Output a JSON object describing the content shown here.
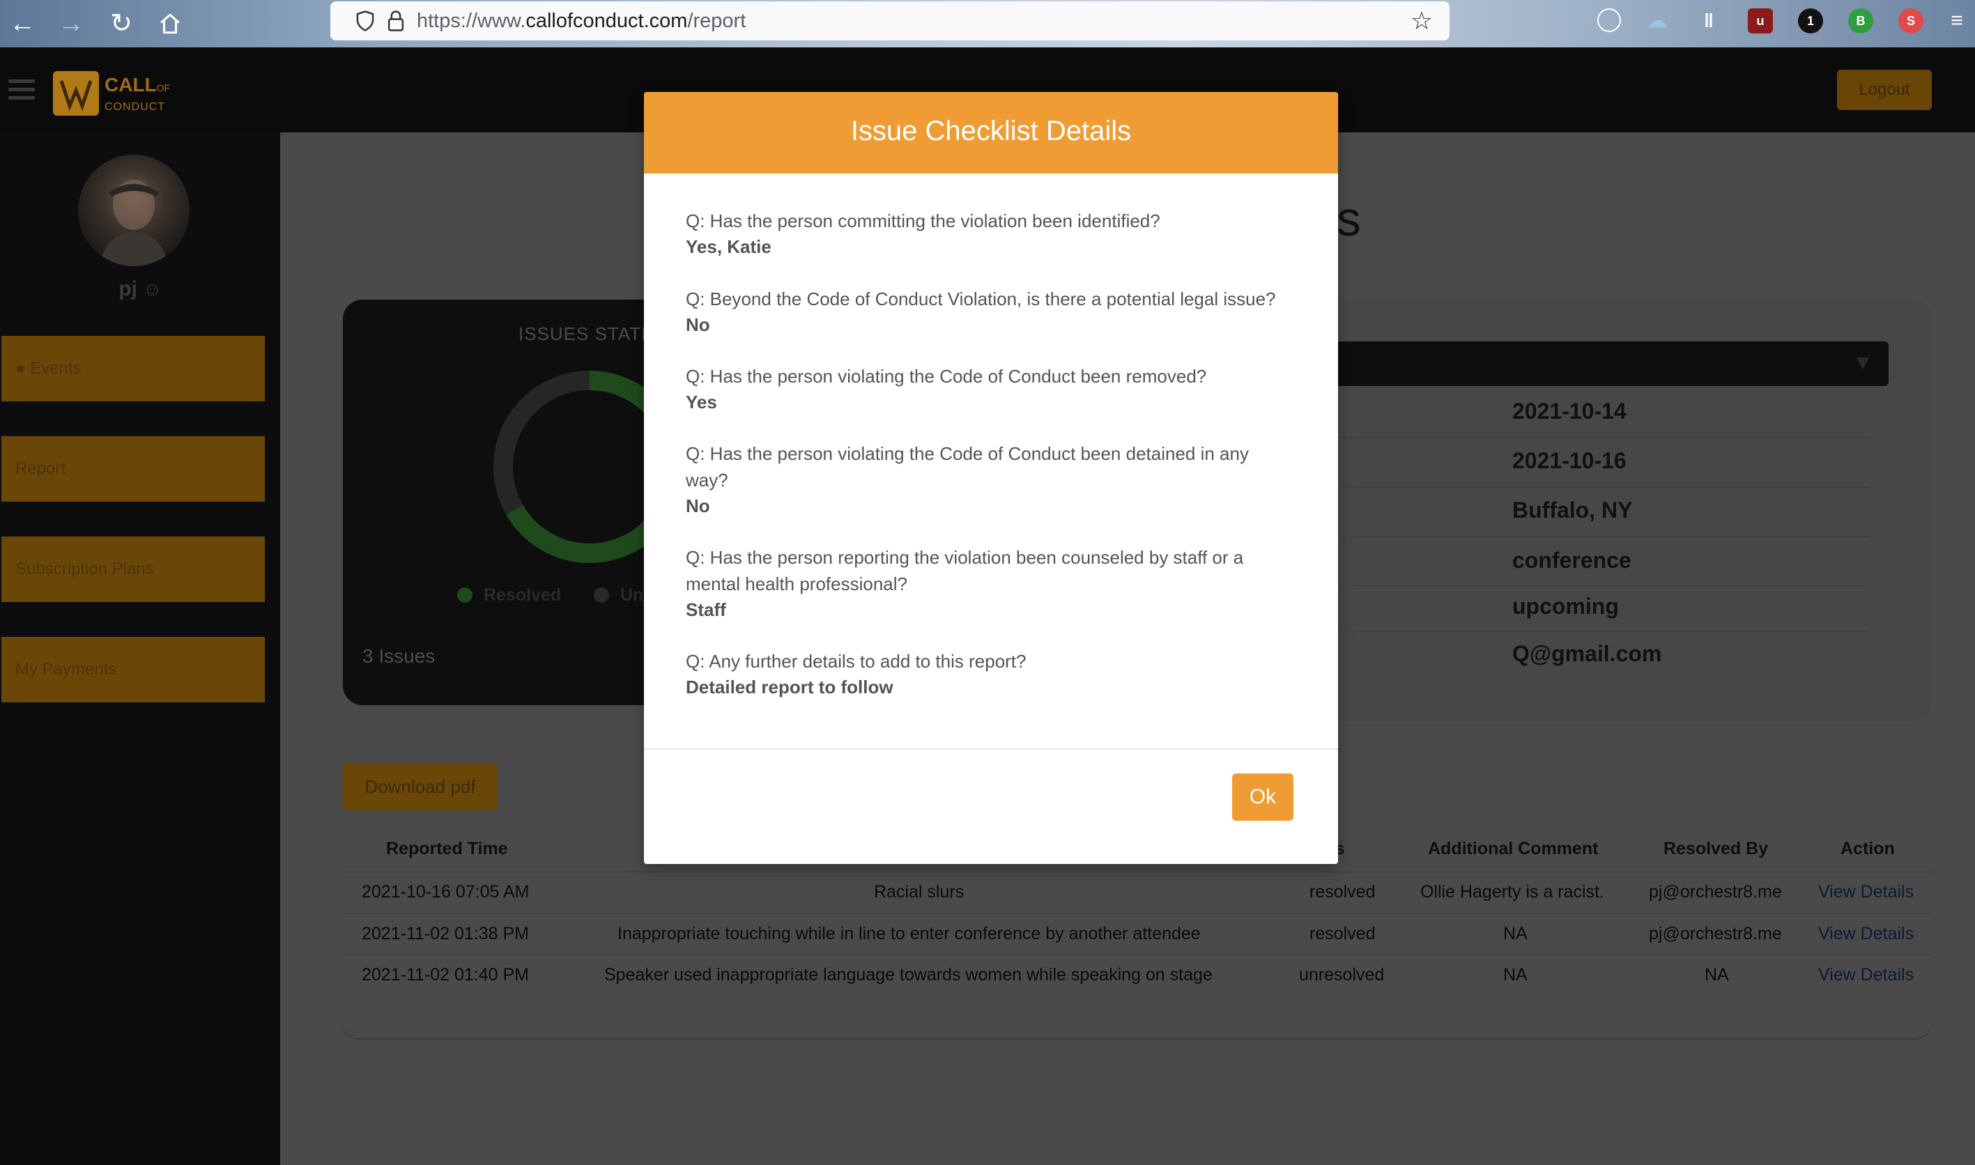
{
  "browser": {
    "url_scheme": "https://www.",
    "url_host": "callofconduct.com",
    "url_path": "/report"
  },
  "header": {
    "logo_main": "CALL",
    "logo_of": "OF",
    "logo_sub": "CONDUCT",
    "logout_label": "Logout"
  },
  "sidebar": {
    "username": "pj",
    "items": [
      {
        "label": "Events"
      },
      {
        "label": "Report"
      },
      {
        "label": "Subscription Plans"
      },
      {
        "label": "My Payments"
      }
    ]
  },
  "main": {
    "title_tail": "s",
    "stats_label": "ISSUES STATIC",
    "legend": [
      {
        "label": "Resolved",
        "color": "#1f4a1b"
      },
      {
        "label": "Un",
        "color": "#2a2a2a"
      }
    ],
    "resolved_fraction": 0.6667,
    "issues_count": "3 Issues",
    "event_info": [
      "2021-10-14",
      "2021-10-16",
      "Buffalo, NY",
      "conference",
      "upcoming",
      "Q@gmail.com"
    ],
    "download_label": "Download pdf"
  },
  "table": {
    "headers": [
      "Reported Time",
      "atus",
      "Additional Comment",
      "Resolved By",
      "Action"
    ],
    "rows": [
      {
        "time": "2021-10-16 07:05 AM",
        "issue": "Racial slurs",
        "status": "resolved",
        "comment": "Ollie Hagerty is a racist.",
        "resolved_by": "pj@orchestr8.me",
        "action": "View Details"
      },
      {
        "time": "2021-11-02 01:38 PM",
        "issue": "Inappropriate touching while in line to enter conference by another attendee",
        "status": "resolved",
        "comment": "NA",
        "resolved_by": "pj@orchestr8.me",
        "action": "View Details"
      },
      {
        "time": "2021-11-02 01:40 PM",
        "issue": "Speaker used inappropriate language towards women while speaking on stage",
        "status": "unresolved",
        "comment": "NA",
        "resolved_by": "NA",
        "action": "View Details"
      }
    ]
  },
  "modal": {
    "title": "Issue Checklist Details",
    "items": [
      {
        "q": "Q: Has the person committing the violation been identified?",
        "a": "Yes, Katie"
      },
      {
        "q": "Q: Beyond the Code of Conduct Violation, is there a potential legal issue?",
        "a": "No"
      },
      {
        "q": "Q: Has the person violating the Code of Conduct been removed?",
        "a": "Yes"
      },
      {
        "q": "Q: Has the person violating the Code of Conduct been detained in any way?",
        "a": "No"
      },
      {
        "q": "Q: Has the person reporting the violation been counseled by staff or a mental health professional?",
        "a": "Staff"
      },
      {
        "q": "Q: Any further details to add to this report?",
        "a": "Detailed report to follow"
      }
    ],
    "ok_label": "Ok"
  },
  "colors": {
    "accent": "#f09c35",
    "modal_header": "#f09c35"
  }
}
